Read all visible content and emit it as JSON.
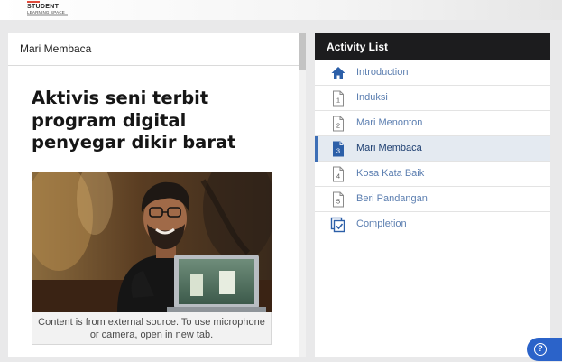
{
  "brand": {
    "line1": "STUDENT",
    "line2": "LEARNING SPACE"
  },
  "content": {
    "panel_title": "Mari Membaca",
    "headline": "Aktivis seni terbit program digital penyegar dikir barat",
    "caption": "Content is from external source. To use microphone or camera, open in new tab."
  },
  "activity_list": {
    "title": "Activity List",
    "items": [
      {
        "label": "Introduction",
        "icon": "home-icon",
        "number": ""
      },
      {
        "label": "Induksi",
        "icon": "page-icon",
        "number": "1"
      },
      {
        "label": "Mari Menonton",
        "icon": "page-icon",
        "number": "2"
      },
      {
        "label": "Mari Membaca",
        "icon": "page-icon",
        "number": "3",
        "active": true
      },
      {
        "label": "Kosa Kata Baik",
        "icon": "page-icon",
        "number": "4"
      },
      {
        "label": "Beri Pandangan",
        "icon": "page-icon",
        "number": "5"
      },
      {
        "label": "Completion",
        "icon": "completion-icon",
        "number": ""
      }
    ]
  },
  "help": {
    "icon": "help-icon",
    "glyph": "?"
  },
  "colors": {
    "accent": "#3e6fb6",
    "header_dark": "#1c1c1e",
    "link_blue": "#5b7eb0",
    "help_blue": "#2b63c9"
  }
}
